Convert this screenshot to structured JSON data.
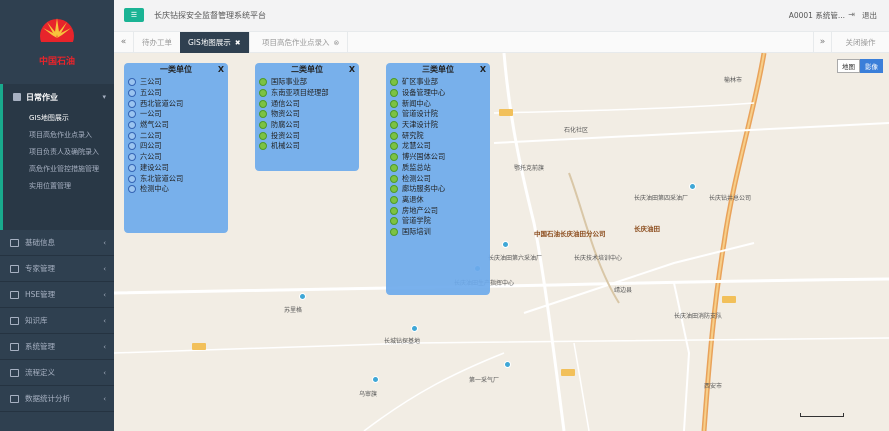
{
  "brand": {
    "logo_text": "中国石油",
    "accent": "#1ab394",
    "sidebar_bg": "#2f4050"
  },
  "sidebar": {
    "active_group": {
      "label": "日常作业",
      "items": [
        {
          "label": "GIS地图展示"
        },
        {
          "label": "项目高危作业点录入"
        },
        {
          "label": "项目负责人及确院录入"
        },
        {
          "label": "高危作业管控措施管理"
        },
        {
          "label": "实用位置管理"
        }
      ]
    },
    "items": [
      {
        "label": "基础信息",
        "icon": "doc-icon"
      },
      {
        "label": "专家管理",
        "icon": "user-icon"
      },
      {
        "label": "HSE管理",
        "icon": "shield-icon"
      },
      {
        "label": "知识库",
        "icon": "book-icon"
      },
      {
        "label": "系统管理",
        "icon": "monitor-icon"
      },
      {
        "label": "流程定义",
        "icon": "flow-icon"
      },
      {
        "label": "数据统计分析",
        "icon": "chart-icon"
      }
    ]
  },
  "topbar": {
    "menu_toggle": "☰",
    "title": "长庆钻探安全监督管理系统平台",
    "user": "A0001 系统管...",
    "logout": "退出"
  },
  "tabs": {
    "prev": "«",
    "next": "»",
    "items": [
      {
        "label": "待办工单",
        "active": false
      },
      {
        "label": "GIS地图展示",
        "active": true
      },
      {
        "label": "项目高危作业点录入",
        "active": false
      }
    ],
    "close_ops": "关闭操作"
  },
  "map": {
    "type_toggle": [
      "地图",
      "影像"
    ],
    "labels": [
      "长庆油田",
      "中国石油长庆油田分公司",
      "石化社区",
      "长庆油田第四采油厂",
      "长庆油田第六采油厂",
      "长庆油田消防支队",
      "长城钻探基地",
      "第一采气厂",
      "苏里格",
      "乌审旗",
      "长庆钻井总公司",
      "长庆技术培训中心",
      "鄂托克前旗",
      "长庆油田生产指挥中心",
      "榆林市",
      "靖边县",
      "西安市"
    ]
  },
  "panels": [
    {
      "title": "一类单位",
      "close": "X",
      "badge_style": "outline",
      "units": [
        "三公司",
        "五公司",
        "西北管道公司",
        "一公司",
        "燃气公司",
        "二公司",
        "四公司",
        "六公司",
        "建设公司",
        "东北管道公司",
        "检测中心"
      ]
    },
    {
      "title": "二类单位",
      "close": "X",
      "badge_style": "green",
      "units": [
        "国际事业部",
        "东南亚项目经理部",
        "通信公司",
        "物资公司",
        "防腐公司",
        "投资公司",
        "机械公司"
      ]
    },
    {
      "title": "三类单位",
      "close": "X",
      "badge_style": "green",
      "units": [
        "矿区事业部",
        "设备管理中心",
        "新闻中心",
        "管道设计院",
        "天津设计院",
        "研究院",
        "龙慧公司",
        "博兴国体公司",
        "质监总站",
        "检测公司",
        "廊坊服务中心",
        "离退休",
        "房地产公司",
        "管道学院",
        "国际培训"
      ]
    }
  ]
}
